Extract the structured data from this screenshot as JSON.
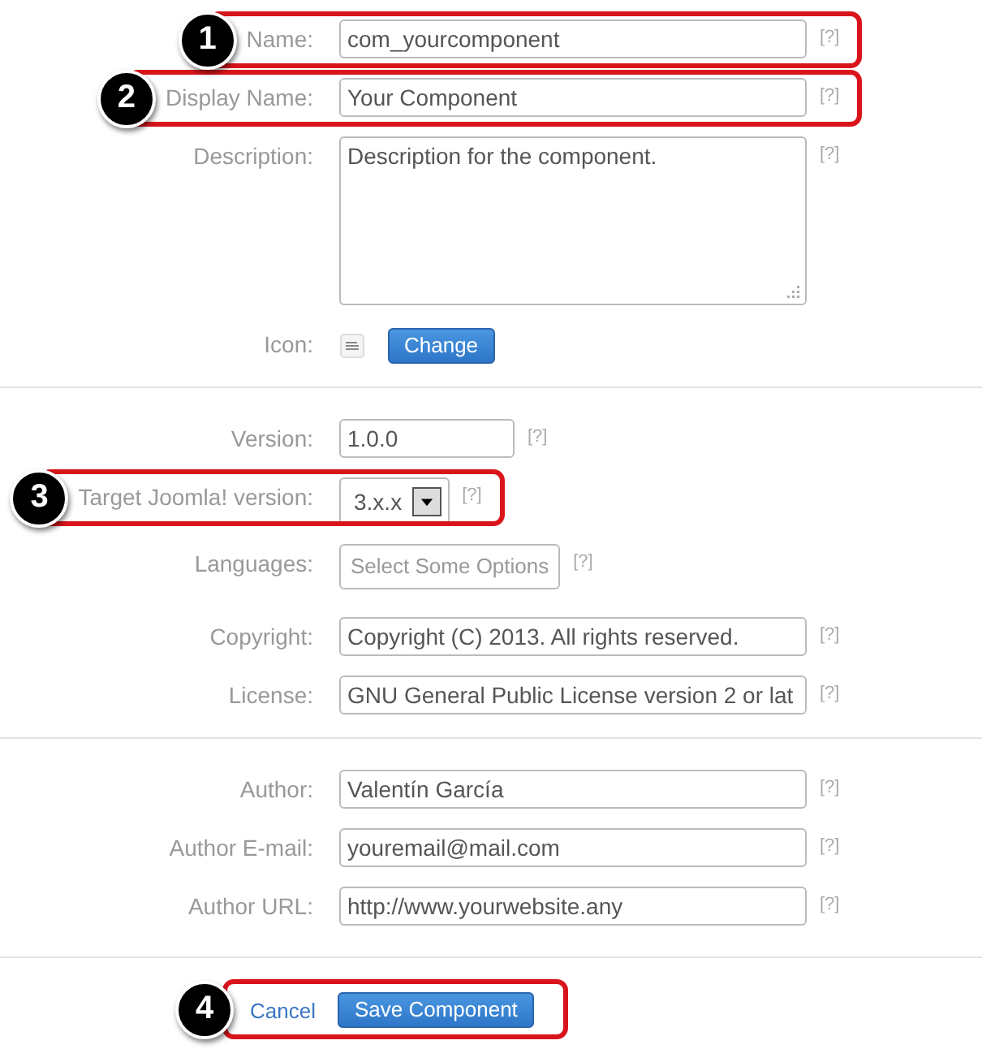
{
  "sections": [
    {
      "fields": [
        {
          "kind": "text",
          "label": "Name:",
          "value": "com_yourcomponent",
          "help": "[?]",
          "callout": "1"
        },
        {
          "kind": "text",
          "label": "Display Name:",
          "value": "Your Component",
          "help": "[?]",
          "callout": "2"
        },
        {
          "kind": "textarea",
          "label": "Description:",
          "value": "Description for the component.",
          "help": "[?]"
        },
        {
          "kind": "icon",
          "label": "Icon:",
          "button": "Change"
        }
      ]
    },
    {
      "fields": [
        {
          "kind": "short",
          "label": "Version:",
          "value": "1.0.0",
          "help": "[?]"
        },
        {
          "kind": "select",
          "label": "Target Joomla! version:",
          "value": "3.x.x",
          "help": "[?]",
          "callout": "3"
        },
        {
          "kind": "multiselect",
          "label": "Languages:",
          "placeholder": "Select Some Options",
          "help": "[?]"
        },
        {
          "kind": "text",
          "label": "Copyright:",
          "value": "Copyright (C) 2013. All rights reserved.",
          "help": "[?]"
        },
        {
          "kind": "text",
          "label": "License:",
          "value": "GNU General Public License version 2 or lat",
          "help": "[?]"
        }
      ]
    },
    {
      "fields": [
        {
          "kind": "text",
          "label": "Author:",
          "value": "Valentín García",
          "help": "[?]"
        },
        {
          "kind": "text",
          "label": "Author E-mail:",
          "value": "youremail@mail.com",
          "help": "[?]"
        },
        {
          "kind": "text",
          "label": "Author URL:",
          "value": "http://www.yourwebsite.any",
          "help": "[?]"
        }
      ]
    }
  ],
  "actions": {
    "callout": "4",
    "cancel": "Cancel",
    "save": "Save Component"
  }
}
